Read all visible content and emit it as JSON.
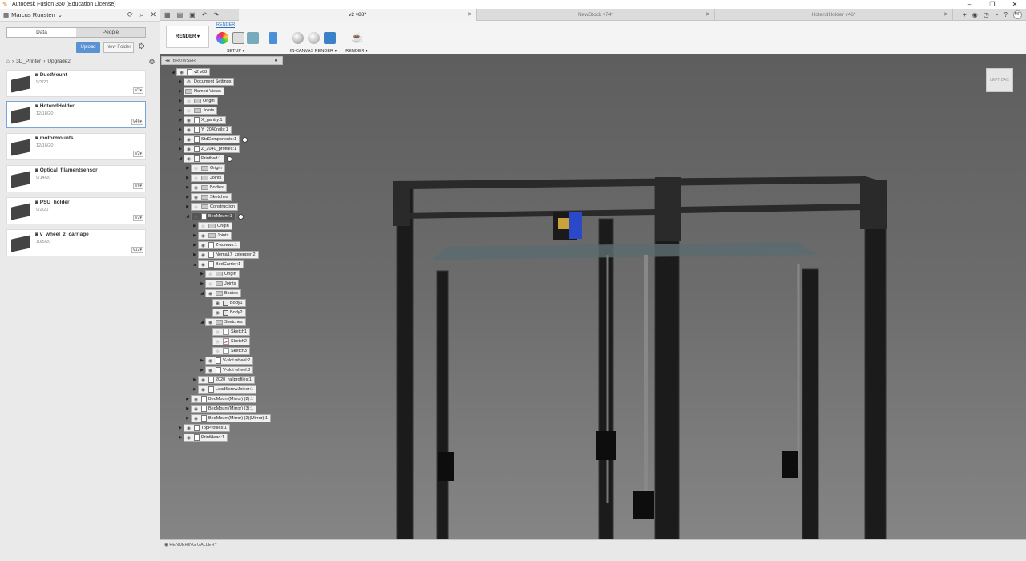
{
  "window": {
    "title": "Autodesk Fusion 360 (Education License)"
  },
  "data_panel": {
    "user": "Marcus Runsten",
    "tabs": [
      "Data",
      "People"
    ],
    "upload": "Upload",
    "new_folder": "New Folder",
    "breadcrumb": [
      "3D_Printer",
      "Upgrade2"
    ],
    "files": [
      {
        "name": "DuetMount",
        "date": "9/3/20",
        "version": "V7"
      },
      {
        "name": "HotendHolder",
        "date": "12/18/20",
        "version": "V46"
      },
      {
        "name": "motormounts",
        "date": "12/16/20",
        "version": "V2"
      },
      {
        "name": "Optical_filamentsensor",
        "date": "9/14/20",
        "version": "V6"
      },
      {
        "name": "PSU_holder",
        "date": "9/2/20",
        "version": "V2"
      },
      {
        "name": "v_wheel_z_carriage",
        "date": "10/5/20",
        "version": "V12"
      }
    ]
  },
  "tabs": [
    {
      "label": "v2 v88*"
    },
    {
      "label": "NewStock v74*"
    },
    {
      "label": "HotendHolder v46*"
    }
  ],
  "toolbar": {
    "workspace": "RENDER",
    "tab": "RENDER",
    "groups": [
      "SETUP",
      "IN-CANVAS RENDER",
      "RENDER"
    ]
  },
  "browser": {
    "title": "BROWSER"
  },
  "tree": [
    {
      "label": "v2 v88",
      "kind": "comp",
      "level": 0,
      "eye": true,
      "open": true,
      "dark": false
    },
    {
      "label": "Document Settings",
      "kind": "gear",
      "level": 1,
      "eye": false,
      "open": false
    },
    {
      "label": "Named Views",
      "kind": "folder",
      "level": 1,
      "eye": false,
      "open": false
    },
    {
      "label": "Origin",
      "kind": "folder",
      "level": 1,
      "eye": "off",
      "open": false
    },
    {
      "label": "Joints",
      "kind": "folder",
      "level": 1,
      "eye": "off",
      "open": false
    },
    {
      "label": "X_gantry:1",
      "kind": "comp",
      "level": 1,
      "eye": true,
      "open": false
    },
    {
      "label": "Y_2040rails:1",
      "kind": "comp",
      "level": 1,
      "eye": true,
      "open": false
    },
    {
      "label": "StdComponents:1",
      "kind": "comp",
      "level": 1,
      "eye": true,
      "open": false,
      "radio": true
    },
    {
      "label": "Z_2040_profiles:1",
      "kind": "comp",
      "level": 1,
      "eye": true,
      "open": false
    },
    {
      "label": "Printbed:1",
      "kind": "comp",
      "level": 1,
      "eye": true,
      "open": true,
      "radio": true
    },
    {
      "label": "Origin",
      "kind": "folder",
      "level": 2,
      "eye": "off",
      "open": false
    },
    {
      "label": "Joints",
      "kind": "folder",
      "level": 2,
      "eye": "off",
      "open": false
    },
    {
      "label": "Bodies",
      "kind": "folder",
      "level": 2,
      "eye": true,
      "open": false
    },
    {
      "label": "Sketches",
      "kind": "folder",
      "level": 2,
      "eye": true,
      "open": false
    },
    {
      "label": "Construction",
      "kind": "folder",
      "level": 2,
      "eye": "off",
      "open": false
    },
    {
      "label": "BedMount:1",
      "kind": "comp",
      "level": 2,
      "eye": true,
      "open": true,
      "dark": true,
      "radio": true
    },
    {
      "label": "Origin",
      "kind": "folder",
      "level": 3,
      "eye": "off",
      "open": false
    },
    {
      "label": "Joints",
      "kind": "folder",
      "level": 3,
      "eye": true,
      "open": false
    },
    {
      "label": "Z-screws:1",
      "kind": "comp",
      "level": 3,
      "eye": true,
      "open": false
    },
    {
      "label": "Nema17_zstepper:2",
      "kind": "comp",
      "level": 3,
      "eye": true,
      "open": false
    },
    {
      "label": "BedCarrier:1",
      "kind": "comp",
      "level": 3,
      "eye": true,
      "open": true
    },
    {
      "label": "Origin",
      "kind": "folder",
      "level": 4,
      "eye": "off",
      "open": false
    },
    {
      "label": "Joints",
      "kind": "folder",
      "level": 4,
      "eye": "off",
      "open": false
    },
    {
      "label": "Bodies",
      "kind": "folder",
      "level": 4,
      "eye": true,
      "open": true
    },
    {
      "label": "Body1",
      "kind": "body",
      "level": 5,
      "eye": true
    },
    {
      "label": "Body2",
      "kind": "body",
      "level": 5,
      "eye": true
    },
    {
      "label": "Sketches",
      "kind": "folder",
      "level": 4,
      "eye": true,
      "open": true
    },
    {
      "label": "Sketch1",
      "kind": "sketch",
      "level": 5,
      "eye": "off"
    },
    {
      "label": "Sketch2",
      "kind": "sketchr",
      "level": 5,
      "eye": "off"
    },
    {
      "label": "Sketch3",
      "kind": "sketch",
      "level": 5,
      "eye": "off"
    },
    {
      "label": "V-slot wheel:2",
      "kind": "comp",
      "level": 4,
      "eye": true,
      "open": false
    },
    {
      "label": "V-slot wheel:3",
      "kind": "comp",
      "level": 4,
      "eye": true,
      "open": false
    },
    {
      "label": "2020_railprofiles:1",
      "kind": "comp",
      "level": 3,
      "eye": true,
      "open": false
    },
    {
      "label": "LeadScrewJoiner:1",
      "kind": "comp",
      "level": 3,
      "eye": true,
      "open": false
    },
    {
      "label": "BedMount(Mirror) (2):1",
      "kind": "comp",
      "level": 2,
      "eye": true,
      "open": false
    },
    {
      "label": "BedMount(Mirror) (3):1",
      "kind": "comp",
      "level": 2,
      "eye": true,
      "open": false
    },
    {
      "label": "BedMount(Mirror) (2)(Mirror):1",
      "kind": "comp",
      "level": 2,
      "eye": true,
      "open": false
    },
    {
      "label": "TopProfiles:1",
      "kind": "comp",
      "level": 1,
      "eye": true,
      "open": false
    },
    {
      "label": "PrintHead:1",
      "kind": "comp",
      "level": 1,
      "eye": true,
      "open": false
    }
  ],
  "viewcube": {
    "left": "LEFT",
    "front": "BAC"
  },
  "gallery": {
    "title": "RENDERING GALLERY"
  }
}
